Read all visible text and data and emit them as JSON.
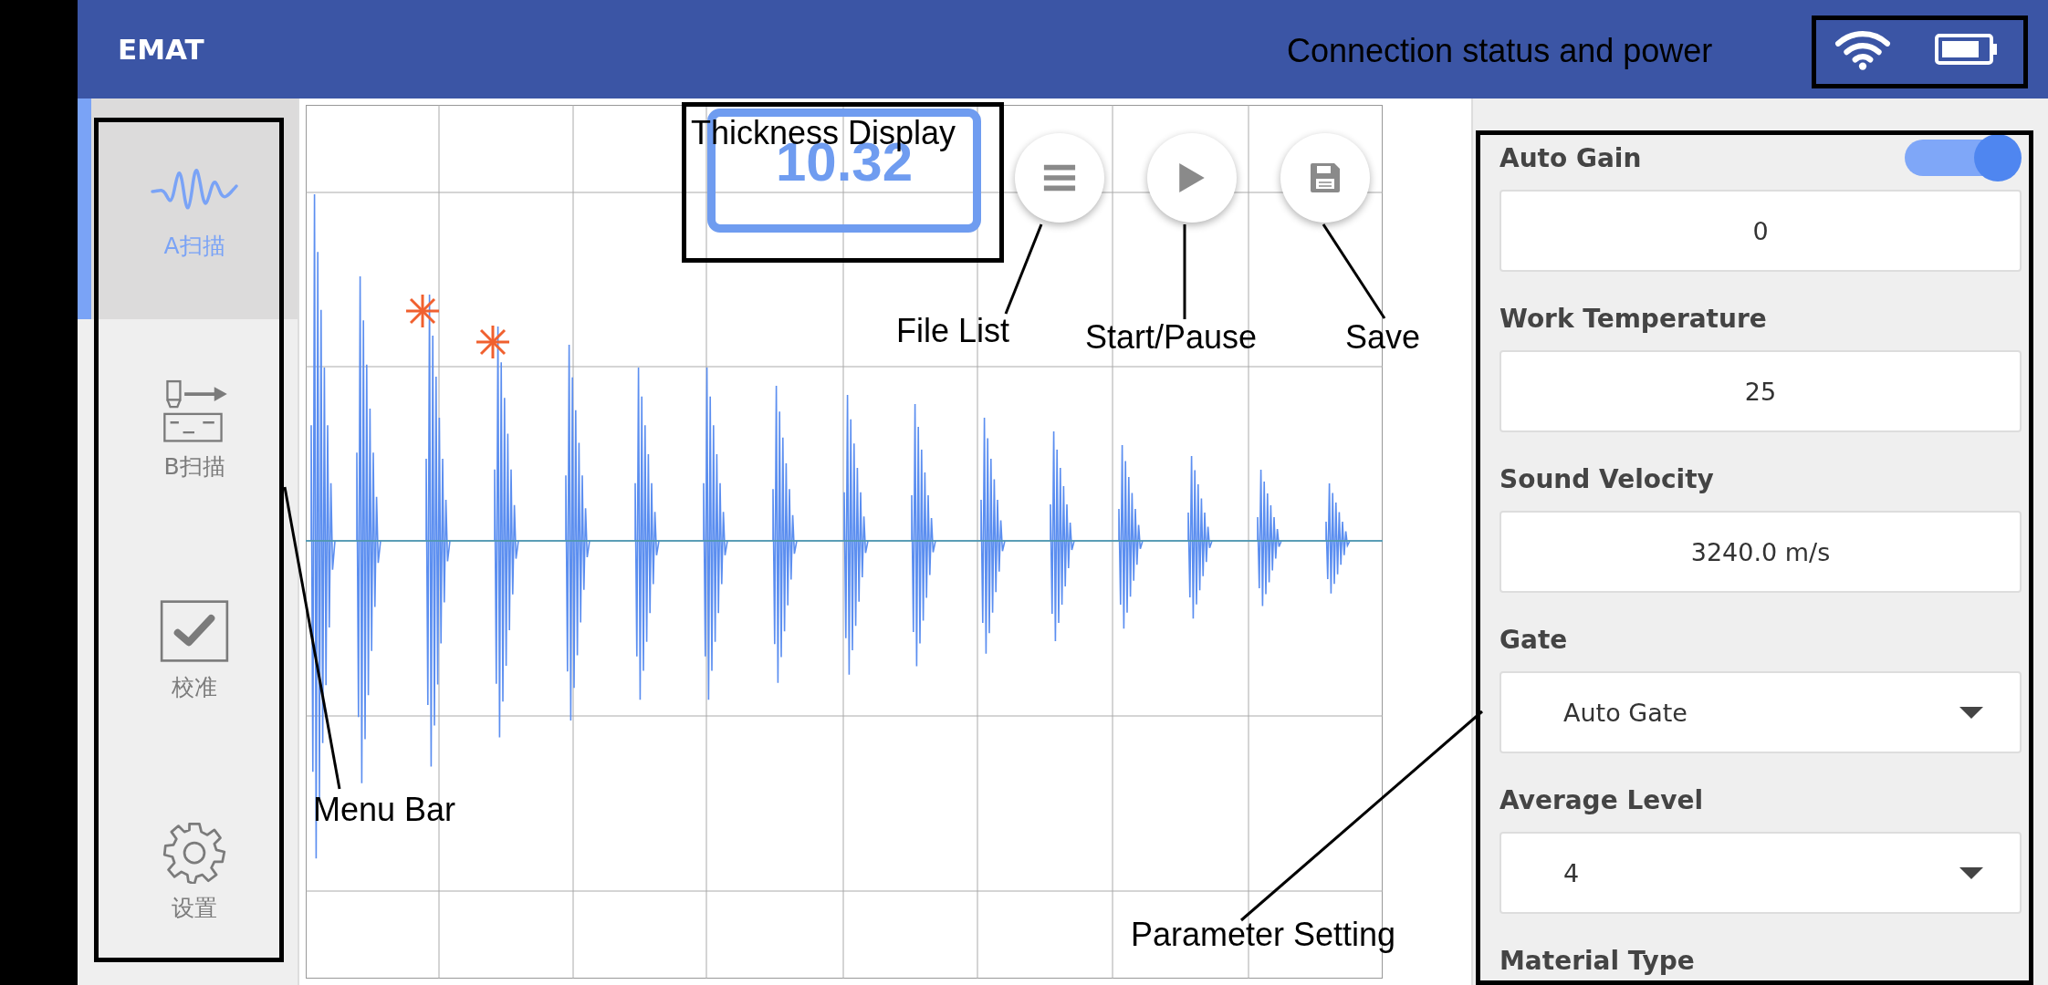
{
  "header": {
    "title": "EMAT"
  },
  "sidebar": {
    "items": [
      {
        "kind": "ascan",
        "label": "A扫描",
        "selected": true
      },
      {
        "kind": "bscan",
        "label": "B扫描",
        "selected": false
      },
      {
        "kind": "calibration",
        "label": "校准",
        "selected": false
      },
      {
        "kind": "settings",
        "label": "设置",
        "selected": false
      }
    ]
  },
  "thickness_display": {
    "value": "10.32"
  },
  "parameters": [
    {
      "label": "Auto Gain",
      "on": true,
      "kind": "input",
      "value": "0"
    },
    {
      "label": "Work Temperature",
      "kind": "input",
      "value": "25"
    },
    {
      "label": "Sound Velocity",
      "kind": "input",
      "value": "3240.0 m/s"
    },
    {
      "label": "Gate",
      "kind": "select",
      "value": "Auto Gate"
    },
    {
      "label": "Average Level",
      "kind": "select",
      "value": "4"
    },
    {
      "label": "Material Type"
    }
  ],
  "annotations": [
    {
      "text": "Connection status and power"
    },
    {
      "text": "Thickness Display"
    },
    {
      "text": "File List"
    },
    {
      "text": "Start/Pause"
    },
    {
      "text": "Save"
    },
    {
      "text": "Menu Bar"
    },
    {
      "text": "Parameter Setting"
    }
  ]
}
